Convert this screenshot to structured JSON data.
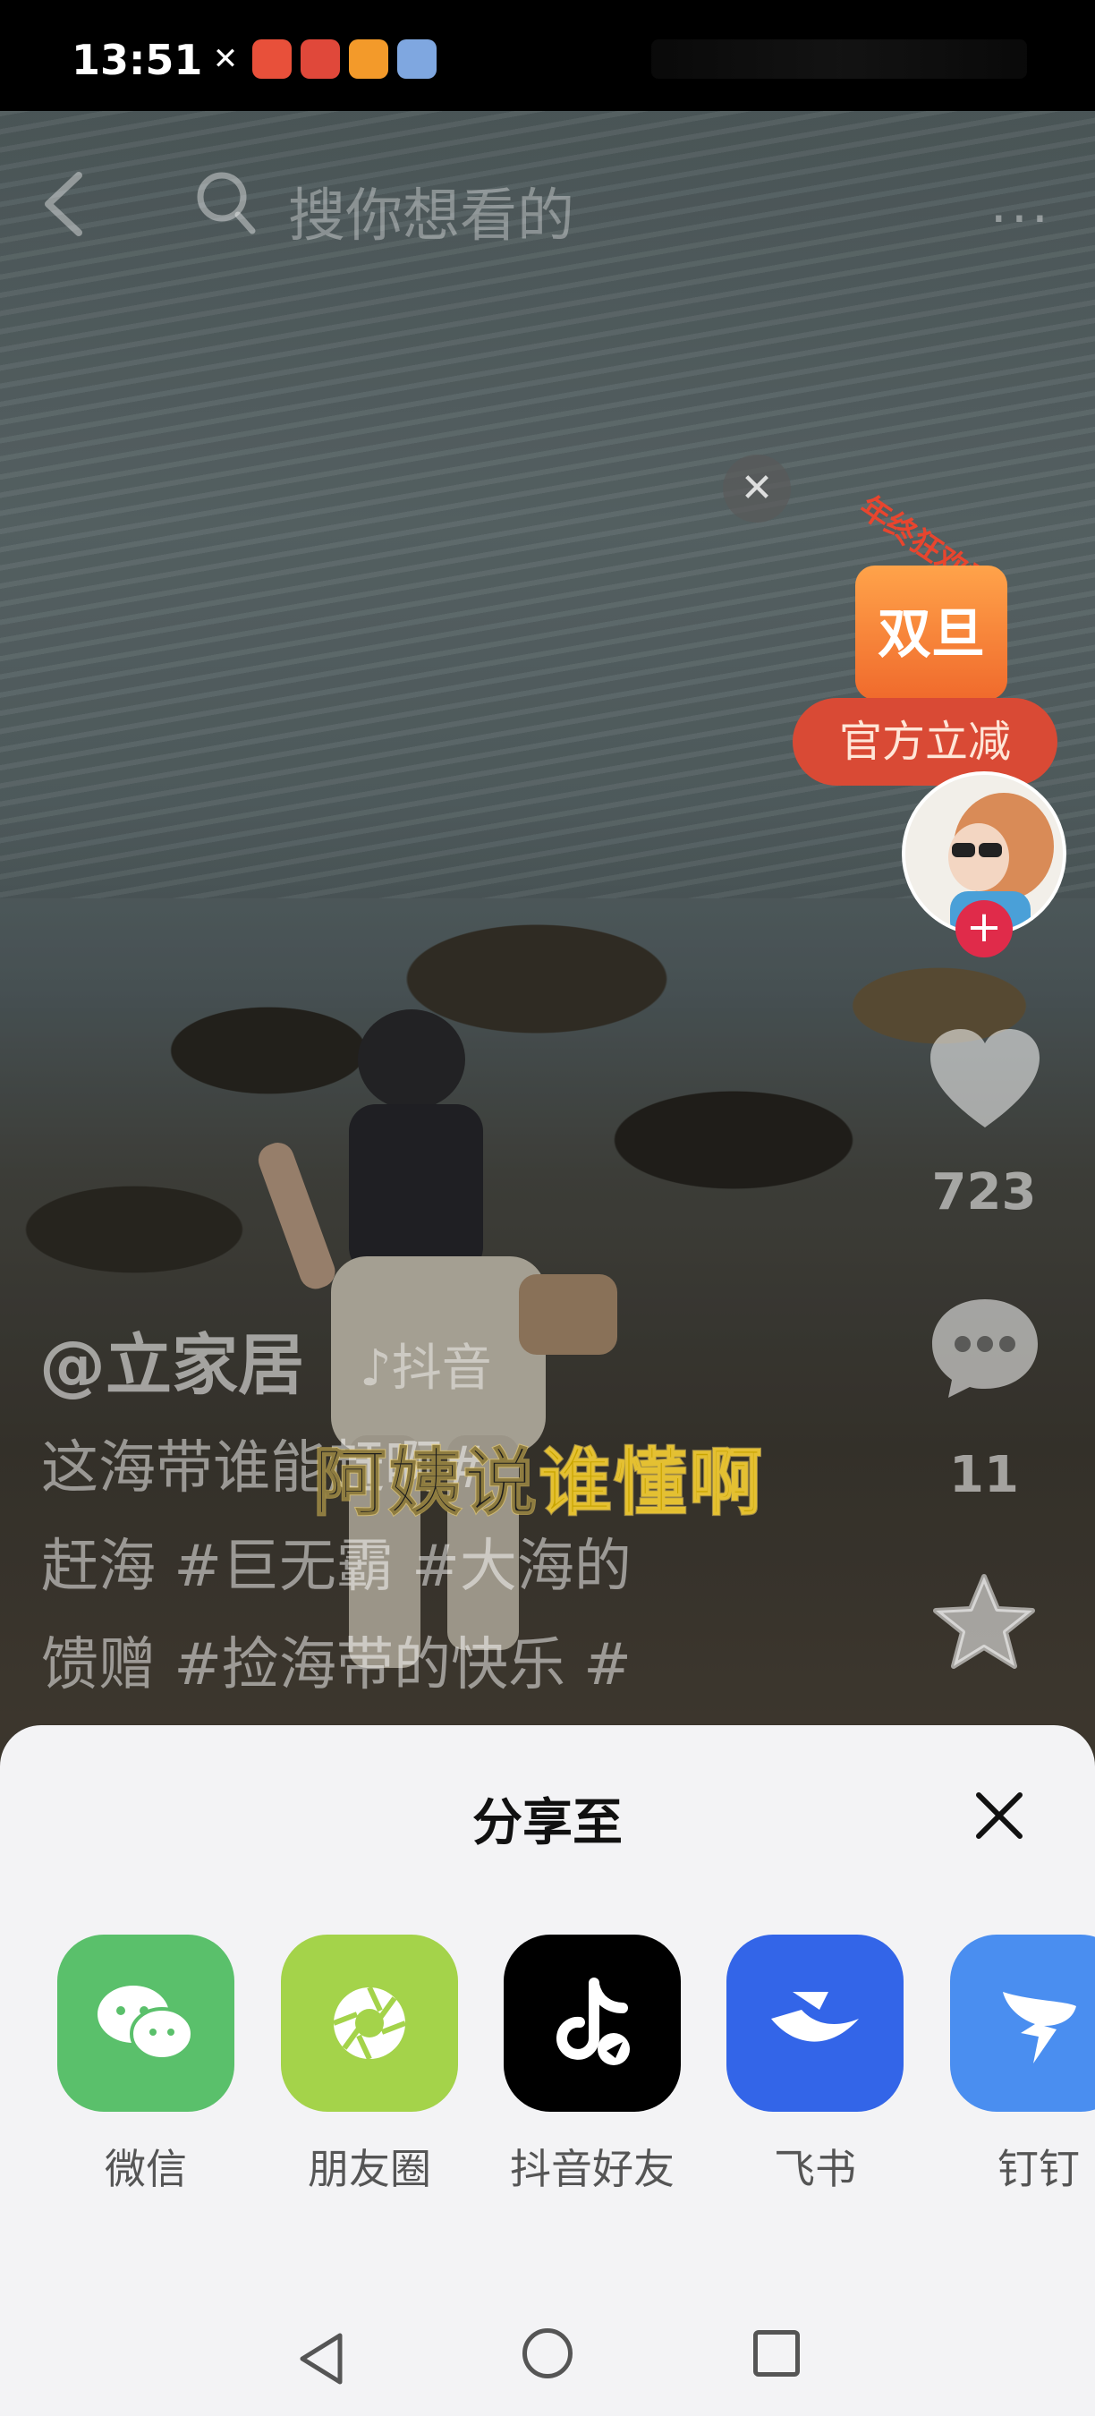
{
  "status_bar": {
    "time": "13:51",
    "icons": [
      "missed-call-icon",
      "app-notification-icon",
      "app-notification-icon",
      "heart-app-icon",
      "app-icon"
    ]
  },
  "top_bar": {
    "search_placeholder": "搜你想看的",
    "more": "···"
  },
  "promo": {
    "arc_text": "年终狂欢季",
    "bag_text": "双旦",
    "badge_text": "官方立减"
  },
  "actions": {
    "like_count": "723",
    "comment_count": "11"
  },
  "caption": {
    "author": "@立家居",
    "platform": "♪抖音",
    "lines": [
      "这海带谁能赶啊#",
      "赶海 #巨无霸 #大海的",
      "馈赠 #捡海带的快乐 #"
    ],
    "subtitle_dark": "阿姨说",
    "subtitle_highlight": "谁懂啊"
  },
  "share_sheet": {
    "title": "分享至",
    "targets": [
      {
        "label": "微信",
        "icon": "wechat-icon"
      },
      {
        "label": "朋友圈",
        "icon": "moments-icon"
      },
      {
        "label": "抖音好友",
        "icon": "douyin-icon"
      },
      {
        "label": "飞书",
        "icon": "feishu-icon"
      },
      {
        "label": "钉钉",
        "icon": "dingtalk-icon"
      }
    ]
  },
  "colors": {
    "wechat": "#5ac06b",
    "moments": "#a4d34a",
    "douyin": "#000000",
    "feishu": "#3365e8",
    "dingtalk": "#4a8ef0",
    "follow": "#e02b4a"
  }
}
